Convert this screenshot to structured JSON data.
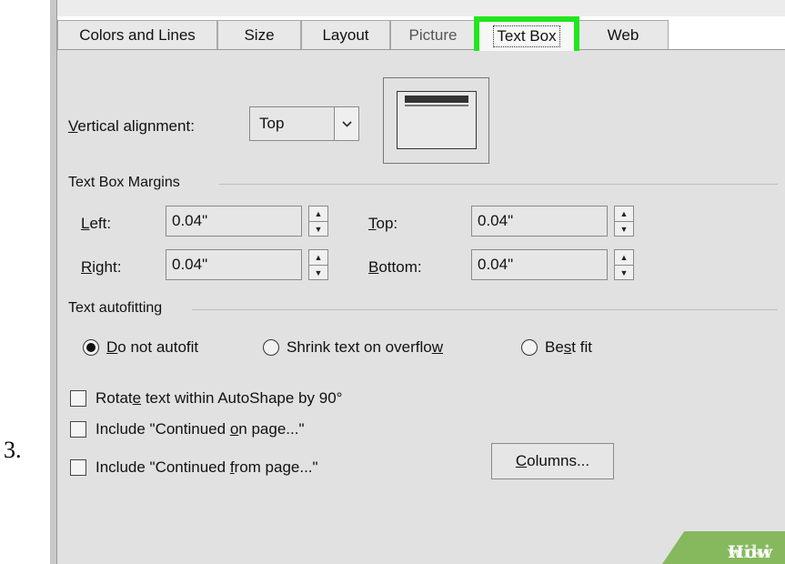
{
  "step_number": "3.",
  "tabs": [
    {
      "label": "Colors and Lines"
    },
    {
      "label": "Size"
    },
    {
      "label": "Layout"
    },
    {
      "label": "Picture"
    },
    {
      "label": "Text Box"
    },
    {
      "label": "Web"
    }
  ],
  "vertical_alignment": {
    "label_prefix": "V",
    "label_rest": "ertical alignment:",
    "value": "Top"
  },
  "margins": {
    "group_label": "Text Box Margins",
    "left": {
      "label_key": "L",
      "label_rest": "eft:",
      "value": "0.04\""
    },
    "right": {
      "label_key": "R",
      "label_rest": "ight:",
      "value": "0.04\""
    },
    "top": {
      "label_key": "T",
      "label_rest": "op:",
      "value": "0.04\""
    },
    "bottom": {
      "label_key": "B",
      "label_rest": "ottom:",
      "value": "0.04\""
    }
  },
  "autofit": {
    "group_label": "Text autofitting",
    "options": [
      {
        "pre": "",
        "key": "D",
        "post": "o not autofit",
        "selected": true
      },
      {
        "pre": "Shrink text on overflo",
        "key": "w",
        "post": "",
        "selected": false
      },
      {
        "pre": "Be",
        "key": "s",
        "post": "t fit",
        "selected": false
      }
    ]
  },
  "checkboxes": [
    {
      "pre": "Rotat",
      "key": "e",
      "post": " text within AutoShape by 90°",
      "checked": false
    },
    {
      "pre": "Include \"Continued ",
      "key": "o",
      "post": "n page...\"",
      "checked": false
    },
    {
      "pre": "Include \"Continued ",
      "key": "f",
      "post": "rom page...\"",
      "checked": false
    }
  ],
  "columns_button": {
    "key": "C",
    "rest": "olumns..."
  },
  "watermark": {
    "part1": "wiki",
    "part2": "How"
  },
  "colors": {
    "highlight": "#22e61c",
    "panel": "#e1e1e1",
    "watermark": "#86b85e"
  }
}
